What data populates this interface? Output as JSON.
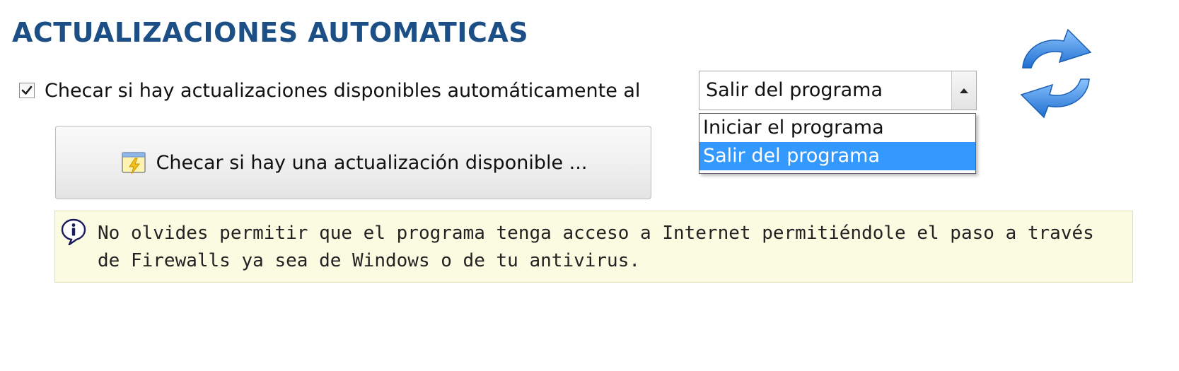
{
  "header": {
    "title": "ACTUALIZACIONES AUTOMATICAS",
    "refresh_icon": "refresh-arrows-icon"
  },
  "auto_check": {
    "checked": true,
    "label": "Checar si hay actualizaciones disponibles automáticamente al"
  },
  "combo": {
    "selected_value": "Salir del programa",
    "expanded": true,
    "options": [
      "Iniciar el programa",
      "Salir del programa"
    ],
    "highlighted_index": 1,
    "highlight_color": "#3399ff"
  },
  "check_button": {
    "label": "Checar si hay una actualización disponible ...",
    "icon": "update-check-icon"
  },
  "info": {
    "icon": "info-balloon-icon",
    "text_line1": "No olvides permitir que el programa tenga acceso a Internet permitiéndole el paso a través",
    "text_line2": "de Firewalls ya sea de Windows o de tu antivirus."
  },
  "colors": {
    "title": "#1c4f86",
    "info_background": "#fbfbe2",
    "refresh_arrows": "#2f7fd8"
  }
}
